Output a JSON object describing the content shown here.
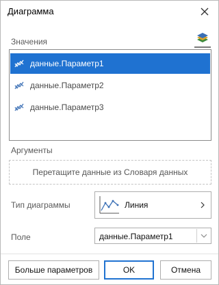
{
  "window": {
    "title": "Диаграмма"
  },
  "values_section": {
    "label": "Значения",
    "items": [
      {
        "label": "данные.Параметр1",
        "icon": "line-series-icon",
        "selected": true
      },
      {
        "label": "данные.Параметр2",
        "icon": "line-series-icon",
        "selected": false
      },
      {
        "label": "данные.Параметр3",
        "icon": "line-series-icon",
        "selected": false
      }
    ]
  },
  "arguments_section": {
    "label": "Аргументы",
    "dropzone_text": "Перетащите данные из Словаря данных"
  },
  "chart_type": {
    "label": "Тип диаграммы",
    "value": "Линия",
    "icon": "line-chart-icon"
  },
  "field": {
    "label": "Поле",
    "value": "данные.Параметр1"
  },
  "buttons": {
    "more": "Больше параметров",
    "ok": "OK",
    "cancel": "Отмена"
  },
  "colors": {
    "selection": "#1f72d1",
    "series_icon": "#3a6fb5",
    "border": "#adadad"
  }
}
